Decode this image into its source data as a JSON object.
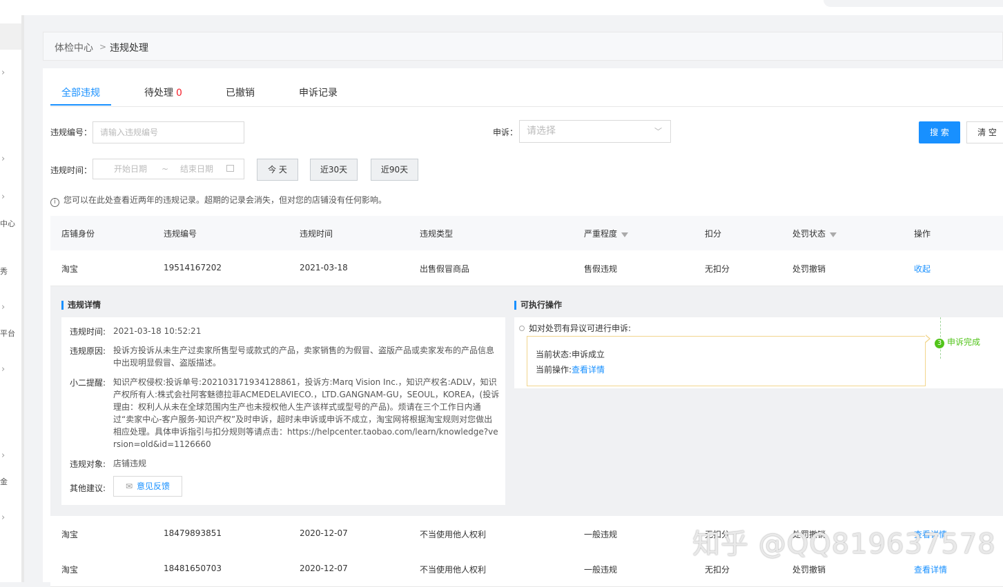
{
  "breadcrumb": {
    "root": "体检中心",
    "separator": ">",
    "current": "违规处理"
  },
  "left_nav": {
    "fragments": [
      "中心",
      "秀",
      "平台",
      "金"
    ]
  },
  "tabs": [
    {
      "label": "全部违规",
      "count": ""
    },
    {
      "label": "待处理",
      "count": "0"
    },
    {
      "label": "已撤销",
      "count": ""
    },
    {
      "label": "申诉记录",
      "count": ""
    }
  ],
  "filters": {
    "violation_id_label": "违规编号",
    "violation_id_placeholder": "请输入违规编号",
    "appeal_label": "申诉",
    "appeal_placeholder": "请选择",
    "time_label": "违规时间",
    "start_placeholder": "开始日期",
    "range_sep": "~",
    "end_placeholder": "结束日期",
    "quick_today": "今 天",
    "quick_30": "近30天",
    "quick_90": "近90天",
    "search": "搜 索",
    "clear": "清 空"
  },
  "notice": "您可以在此处查看近两年的违规记录。超期的记录会消失，但对您的店铺没有任何影响。",
  "table": {
    "columns": [
      "店铺身份",
      "违规编号",
      "违规时间",
      "违规类型",
      "严重程度",
      "扣分",
      "处罚状态",
      "操作"
    ],
    "rows": [
      {
        "shop": "淘宝",
        "id": "19514167202",
        "time": "2021-03-18",
        "type": "出售假冒商品",
        "severity": "售假违规",
        "points": "无扣分",
        "status": "处罚撤销",
        "action": "收起"
      },
      {
        "shop": "淘宝",
        "id": "18479893851",
        "time": "2020-12-07",
        "type": "不当使用他人权利",
        "severity": "一般违规",
        "points": "无扣分",
        "status": "处罚撤销",
        "action": "查看详情"
      },
      {
        "shop": "淘宝",
        "id": "18481650703",
        "time": "2020-12-07",
        "type": "不当使用他人权利",
        "severity": "一般违规",
        "points": "无扣分",
        "status": "处罚撤销",
        "action": "查看详情"
      }
    ]
  },
  "detail": {
    "title": "违规详情",
    "time_label": "违规时间:",
    "time_value": "2021-03-18 10:52:21",
    "reason_label": "违规原因:",
    "reason_value": "投诉方投诉从未生产过卖家所售型号或款式的产品，卖家销售的为假冒、盗版产品或卖家发布的产品信息中出现明显假冒、盗版描述。",
    "tip_label": "小二提醒:",
    "tip_value": "知识产权侵权:投诉单号:2021031719341288​61，投诉方:Marq Vision Inc.，知识产权名:ADLV，知识产权所有人:株式会社阿客魅德拉菲ACMEDELAVIECO.，LTD.GANGNAM-GU，SEOUL，KOREA，(投诉理由：权利人从未在全球范围内生产也未授权他人生产该样式或型号的产品)。烦请在三个工作日内通过“卖家中心-客户服务-知识产权”及时申诉，超时未申诉或申诉不成立，淘宝网将根据淘宝规则对您做出相应处理。具体申诉指引与扣分规则等请点击：https://helpcenter.taobao.com/learn/knowledge?version=old&id=1126660",
    "target_label": "违规对象:",
    "target_value": "店铺违规",
    "suggest_label": "其他建议:",
    "feedback_button": "意见反馈"
  },
  "actions": {
    "title": "可执行操作",
    "head": "如对处罚有异议可进行申诉:",
    "status_label": "当前状态:",
    "status_value": "申诉成立",
    "op_label": "当前操作:",
    "op_link": "查看详情",
    "step_num": "3",
    "step_label": "申诉完成"
  },
  "watermark": "知乎 @QQ819637578"
}
